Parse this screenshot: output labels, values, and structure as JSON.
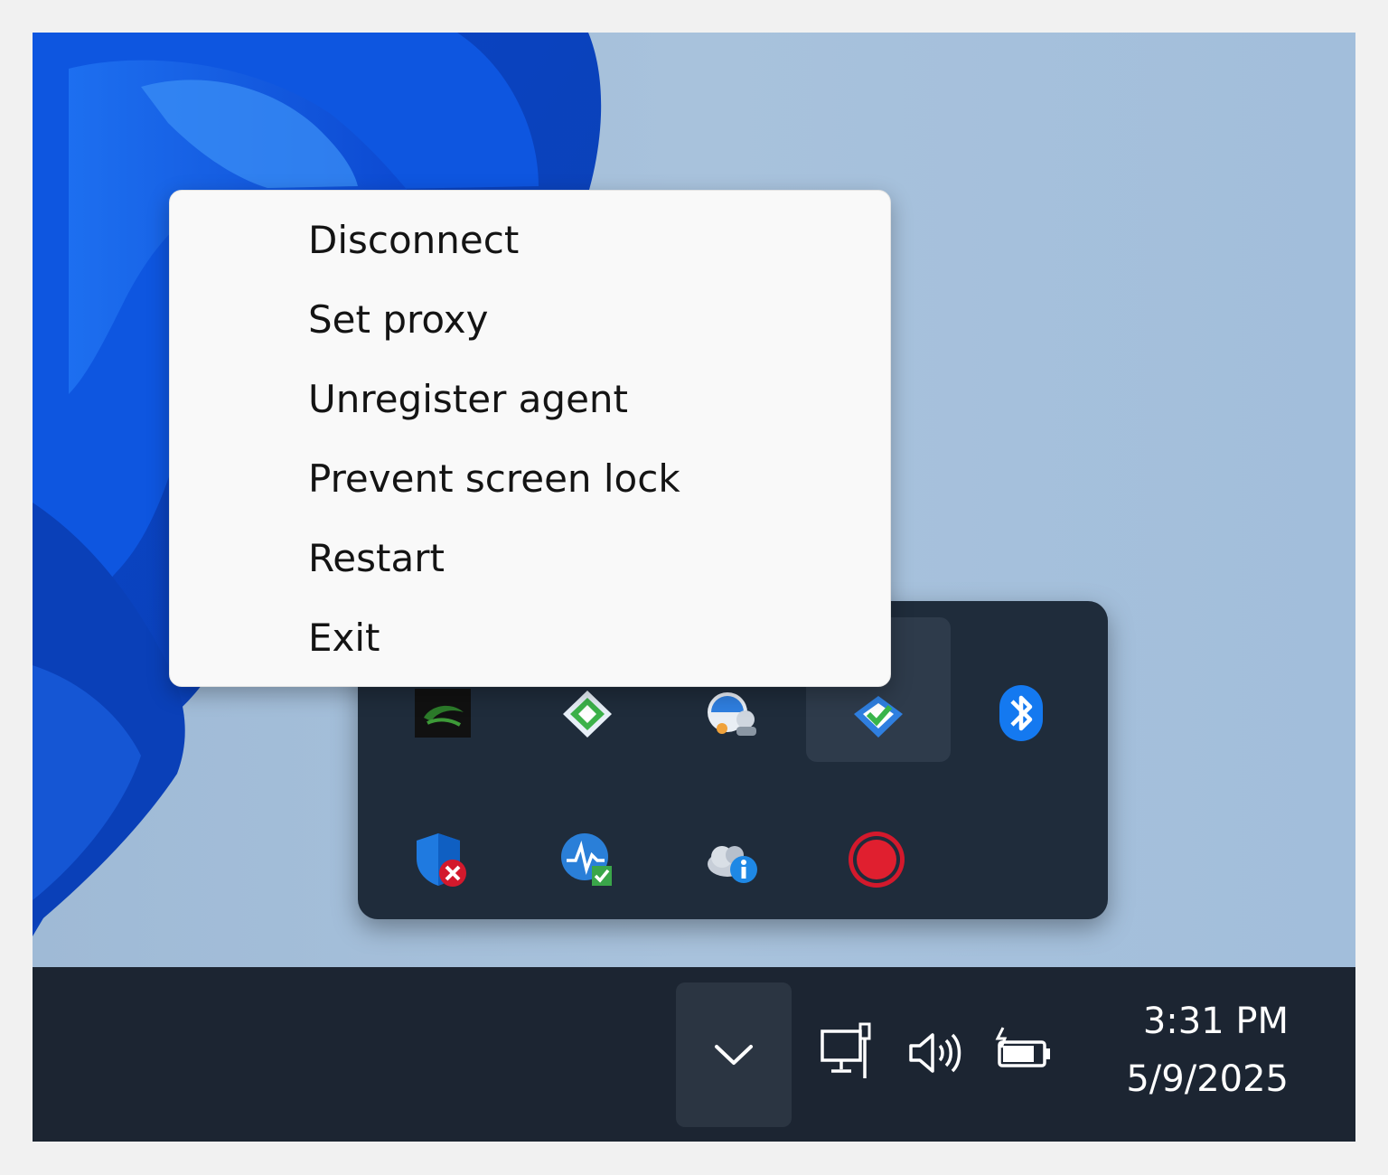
{
  "context_menu": {
    "items": [
      {
        "label": "Disconnect"
      },
      {
        "label": "Set proxy"
      },
      {
        "label": "Unregister agent"
      },
      {
        "label": "Prevent screen lock"
      },
      {
        "label": "Restart"
      },
      {
        "label": "Exit"
      }
    ]
  },
  "tray_flyout": {
    "icons": [
      {
        "name": "nvidia-icon"
      },
      {
        "name": "sync-app-icon"
      },
      {
        "name": "network-user-icon"
      },
      {
        "name": "remote-agent-icon",
        "state": "hovered"
      },
      {
        "name": "bluetooth-icon"
      },
      {
        "name": "defender-alert-icon"
      },
      {
        "name": "monitor-ok-icon"
      },
      {
        "name": "cloud-info-icon"
      },
      {
        "name": "record-icon"
      }
    ]
  },
  "taskbar": {
    "clock": {
      "time": "3:31 PM",
      "date": "5/9/2025"
    },
    "system_icons": [
      "network-ethernet-icon",
      "volume-icon",
      "battery-charging-icon"
    ],
    "chevron_icon": "chevron-down-icon"
  },
  "colors": {
    "taskbar_bg": "#1c2532",
    "flyout_bg": "#1f2c3b",
    "menu_bg": "#f9f9f9",
    "bluetooth_blue": "#1479f0",
    "record_red": "#d3192c"
  }
}
